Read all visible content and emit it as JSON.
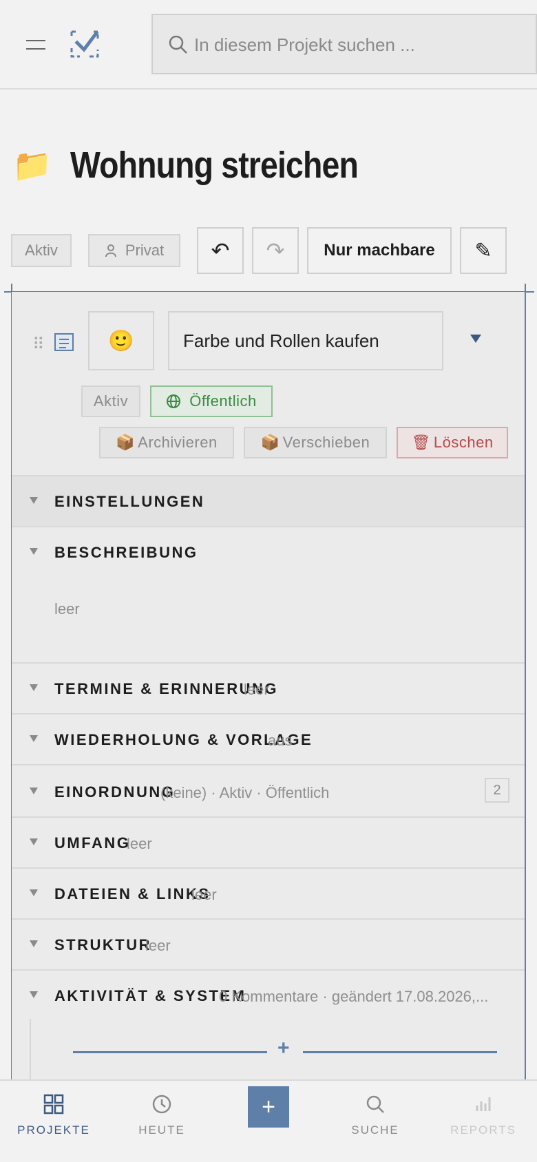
{
  "header": {
    "search_placeholder": "In diesem Projekt suchen ..."
  },
  "project": {
    "icon": "📁",
    "title": "Wohnung streichen"
  },
  "toolbar": {
    "status": "Aktiv",
    "visibility": "Privat",
    "undo": "↶",
    "redo": "↷",
    "filter": "Nur machbare",
    "edit": "✎"
  },
  "task": {
    "emoji": "🙂",
    "title": "Farbe und Rollen kaufen",
    "status": "Aktiv",
    "visibility": "Öffentlich",
    "archive": "Archivieren",
    "move": "Verschieben",
    "delete": "Löschen",
    "archive_icon": "📦",
    "move_icon": "📦",
    "delete_icon": "🗑"
  },
  "sections": {
    "settings": {
      "title": "EINSTELLUNGEN"
    },
    "description": {
      "title": "BESCHREIBUNG",
      "body": "leer"
    },
    "dates": {
      "title": "TERMINE & ERINNERUNG",
      "meta": "leer"
    },
    "repeat": {
      "title": "WIEDERHOLUNG & VORLAGE",
      "meta": "aus"
    },
    "classification": {
      "title": "EINORDNUNG",
      "meta": "(keine) · Aktiv · Öffentlich",
      "count": "2"
    },
    "scope": {
      "title": "UMFANG",
      "meta": "leer"
    },
    "files": {
      "title": "DATEIEN & LINKS",
      "meta": "leer"
    },
    "structure": {
      "title": "STRUKTUR",
      "meta": "leer"
    },
    "activity": {
      "title": "AKTIVITÄT & SYSTEM",
      "meta": "0 Kommentare · geändert 17.08.2026,..."
    }
  },
  "add": {
    "label": "+"
  },
  "nav": {
    "projects": "PROJEKTE",
    "today": "HEUTE",
    "add": "+",
    "search": "SUCHE",
    "reports": "REPORTS"
  },
  "colors": {
    "accent": "#5d7fa8",
    "green": "#3a8a44",
    "red": "#b84a4a"
  }
}
